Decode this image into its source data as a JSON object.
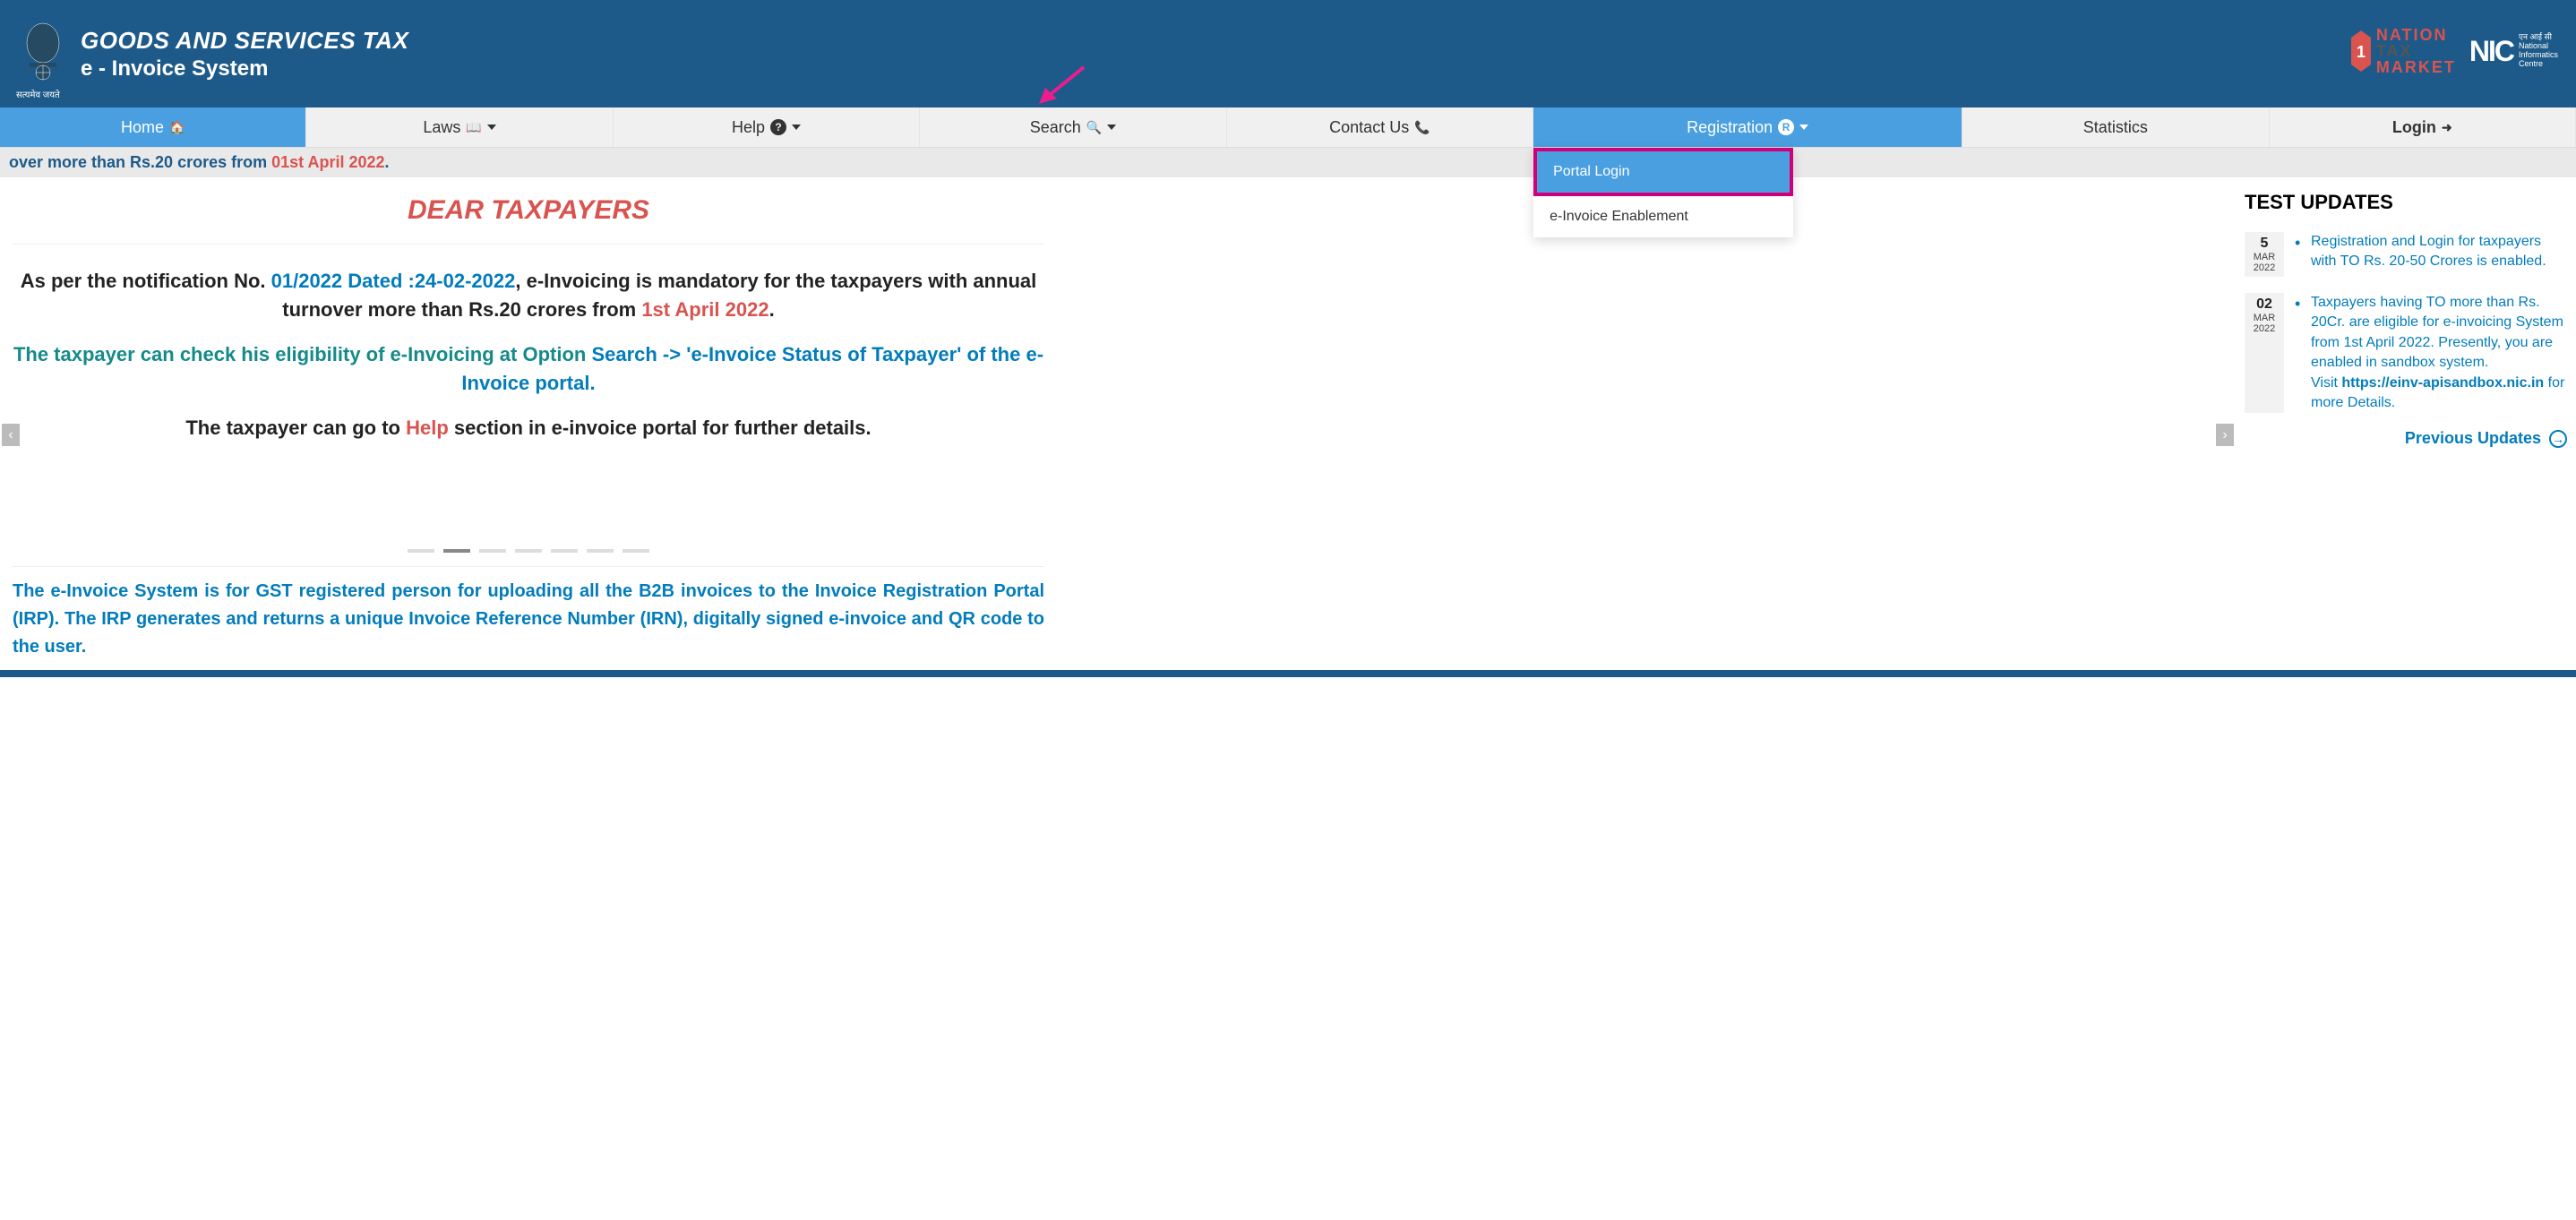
{
  "header": {
    "title1": "GOODS AND SERVICES TAX",
    "title2": "e - Invoice System",
    "satyameva": "सत्यमेव जयते",
    "ntm_l1": "NATION",
    "ntm_l2": "TAX",
    "ntm_l3": "MARKET",
    "nic_label": "NIC",
    "nic_sub1": "एन आई सी",
    "nic_sub2": "National",
    "nic_sub3": "Informatics",
    "nic_sub4": "Centre"
  },
  "nav": {
    "home": "Home",
    "laws": "Laws",
    "help": "Help",
    "search": "Search",
    "contact": "Contact Us",
    "registration": "Registration",
    "statistics": "Statistics",
    "login": "Login"
  },
  "dropdown": {
    "portal_login": "Portal Login",
    "einv_enablement": "e-Invoice Enablement"
  },
  "ticker": {
    "part1": "over more than Rs.20 crores from ",
    "part2": "01st April 2022",
    "part3": "."
  },
  "content": {
    "dear": "DEAR TAXPAYERS",
    "p1_a": "As per the notification No. ",
    "p1_b": "01/2022 Dated :24-02-2022",
    "p1_c": ", e-Invoicing is mandatory for the taxpayers with annual turnover more than Rs.20 crores from ",
    "p1_d": "1st April 2022",
    "p1_e": ".",
    "p2_a": "The taxpayer can check his eligibility of e-Invoicing at Option ",
    "p2_b": "Search -> 'e-Invoice Status of Taxpayer' of the e-Invoice portal.",
    "p3_a": "The taxpayer can go to ",
    "p3_b": "Help",
    "p3_c": " section in e-invoice portal for further details.",
    "info": "The e-Invoice System is for GST registered person for uploading all the B2B invoices to the Invoice Registration Portal (IRP). The IRP generates and returns a unique Invoice Reference Number (IRN), digitally signed e-invoice and QR code to the user."
  },
  "sidebar": {
    "title": "TEST UPDATES",
    "items": [
      {
        "day": "5",
        "mon": "MAR",
        "yr": "2022",
        "text": "Registration and Login for taxpayers with TO Rs. 20-50 Crores is enabled."
      },
      {
        "day": "02",
        "mon": "MAR",
        "yr": "2022",
        "text_a": "Taxpayers having TO more than Rs. 20Cr. are eligible for e-invoicing System from 1st April 2022. Presently, you are enabled in sandbox system.",
        "text_b": "Visit ",
        "text_c": "https://einv-apisandbox.nic.in",
        "text_d": " for more Details."
      }
    ],
    "prev": "Previous Updates"
  }
}
